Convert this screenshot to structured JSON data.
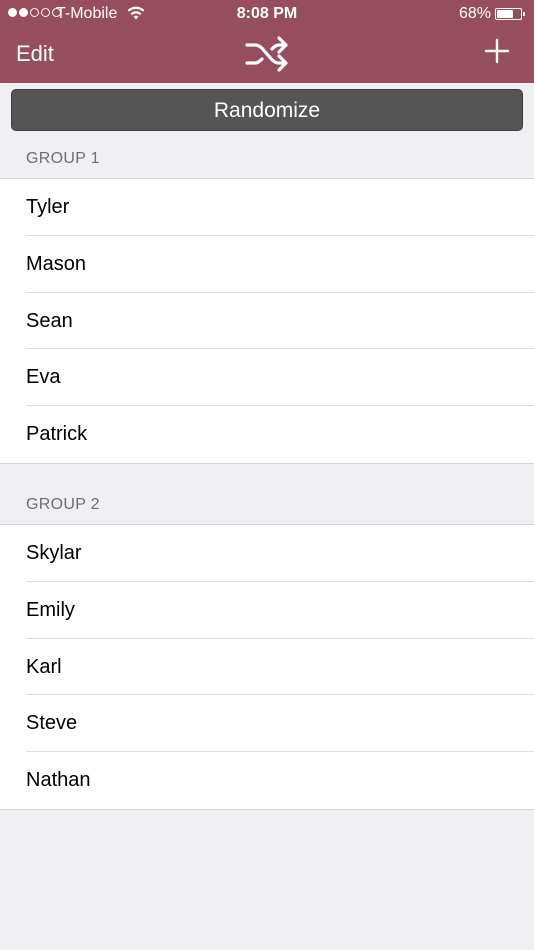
{
  "status_bar": {
    "carrier": "T-Mobile",
    "time": "8:08 PM",
    "battery_percent": "68%",
    "signal_bars_filled": 2,
    "signal_bars_total": 5,
    "battery_level": 0.68
  },
  "nav": {
    "edit_label": "Edit",
    "center_icon": "shuffle-icon",
    "right_icon": "plus-icon"
  },
  "randomize_label": "Randomize",
  "groups": [
    {
      "header": "GROUP 1",
      "members": [
        "Tyler",
        "Mason",
        "Sean",
        "Eva",
        "Patrick"
      ]
    },
    {
      "header": "GROUP 2",
      "members": [
        "Skylar",
        "Emily",
        "Karl",
        "Steve",
        "Nathan"
      ]
    }
  ],
  "colors": {
    "nav_background": "#964e5f",
    "button_background": "#555555",
    "page_background": "#efeff4"
  }
}
